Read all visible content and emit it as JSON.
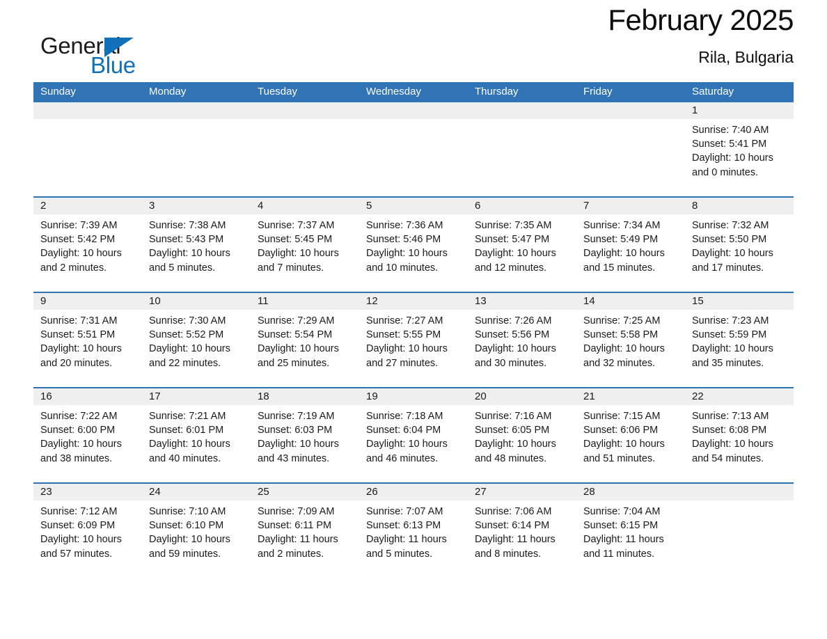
{
  "logo": {
    "word_one": "General",
    "word_two": "Blue",
    "triangle_icon": "triangle-icon",
    "brand_color": "#1270b8"
  },
  "header": {
    "title": "February 2025",
    "subtitle": "Rila, Bulgaria"
  },
  "colors": {
    "header_blue": "#3074b5",
    "row_divider_blue": "#2f72b3",
    "daynum_band": "#efefef",
    "text": "#1a1a1a"
  },
  "weekdays": [
    "Sunday",
    "Monday",
    "Tuesday",
    "Wednesday",
    "Thursday",
    "Friday",
    "Saturday"
  ],
  "labels": {
    "sunrise_prefix": "Sunrise:",
    "sunset_prefix": "Sunset:",
    "daylight_prefix": "Daylight:"
  },
  "weeks": [
    [
      {
        "day": "",
        "empty": true
      },
      {
        "day": "",
        "empty": true
      },
      {
        "day": "",
        "empty": true
      },
      {
        "day": "",
        "empty": true
      },
      {
        "day": "",
        "empty": true
      },
      {
        "day": "",
        "empty": true
      },
      {
        "day": "1",
        "sunrise": "Sunrise: 7:40 AM",
        "sunset": "Sunset: 5:41 PM",
        "daylight": "Daylight: 10 hours and 0 minutes."
      }
    ],
    [
      {
        "day": "2",
        "sunrise": "Sunrise: 7:39 AM",
        "sunset": "Sunset: 5:42 PM",
        "daylight": "Daylight: 10 hours and 2 minutes."
      },
      {
        "day": "3",
        "sunrise": "Sunrise: 7:38 AM",
        "sunset": "Sunset: 5:43 PM",
        "daylight": "Daylight: 10 hours and 5 minutes."
      },
      {
        "day": "4",
        "sunrise": "Sunrise: 7:37 AM",
        "sunset": "Sunset: 5:45 PM",
        "daylight": "Daylight: 10 hours and 7 minutes."
      },
      {
        "day": "5",
        "sunrise": "Sunrise: 7:36 AM",
        "sunset": "Sunset: 5:46 PM",
        "daylight": "Daylight: 10 hours and 10 minutes."
      },
      {
        "day": "6",
        "sunrise": "Sunrise: 7:35 AM",
        "sunset": "Sunset: 5:47 PM",
        "daylight": "Daylight: 10 hours and 12 minutes."
      },
      {
        "day": "7",
        "sunrise": "Sunrise: 7:34 AM",
        "sunset": "Sunset: 5:49 PM",
        "daylight": "Daylight: 10 hours and 15 minutes."
      },
      {
        "day": "8",
        "sunrise": "Sunrise: 7:32 AM",
        "sunset": "Sunset: 5:50 PM",
        "daylight": "Daylight: 10 hours and 17 minutes."
      }
    ],
    [
      {
        "day": "9",
        "sunrise": "Sunrise: 7:31 AM",
        "sunset": "Sunset: 5:51 PM",
        "daylight": "Daylight: 10 hours and 20 minutes."
      },
      {
        "day": "10",
        "sunrise": "Sunrise: 7:30 AM",
        "sunset": "Sunset: 5:52 PM",
        "daylight": "Daylight: 10 hours and 22 minutes."
      },
      {
        "day": "11",
        "sunrise": "Sunrise: 7:29 AM",
        "sunset": "Sunset: 5:54 PM",
        "daylight": "Daylight: 10 hours and 25 minutes."
      },
      {
        "day": "12",
        "sunrise": "Sunrise: 7:27 AM",
        "sunset": "Sunset: 5:55 PM",
        "daylight": "Daylight: 10 hours and 27 minutes."
      },
      {
        "day": "13",
        "sunrise": "Sunrise: 7:26 AM",
        "sunset": "Sunset: 5:56 PM",
        "daylight": "Daylight: 10 hours and 30 minutes."
      },
      {
        "day": "14",
        "sunrise": "Sunrise: 7:25 AM",
        "sunset": "Sunset: 5:58 PM",
        "daylight": "Daylight: 10 hours and 32 minutes."
      },
      {
        "day": "15",
        "sunrise": "Sunrise: 7:23 AM",
        "sunset": "Sunset: 5:59 PM",
        "daylight": "Daylight: 10 hours and 35 minutes."
      }
    ],
    [
      {
        "day": "16",
        "sunrise": "Sunrise: 7:22 AM",
        "sunset": "Sunset: 6:00 PM",
        "daylight": "Daylight: 10 hours and 38 minutes."
      },
      {
        "day": "17",
        "sunrise": "Sunrise: 7:21 AM",
        "sunset": "Sunset: 6:01 PM",
        "daylight": "Daylight: 10 hours and 40 minutes."
      },
      {
        "day": "18",
        "sunrise": "Sunrise: 7:19 AM",
        "sunset": "Sunset: 6:03 PM",
        "daylight": "Daylight: 10 hours and 43 minutes."
      },
      {
        "day": "19",
        "sunrise": "Sunrise: 7:18 AM",
        "sunset": "Sunset: 6:04 PM",
        "daylight": "Daylight: 10 hours and 46 minutes."
      },
      {
        "day": "20",
        "sunrise": "Sunrise: 7:16 AM",
        "sunset": "Sunset: 6:05 PM",
        "daylight": "Daylight: 10 hours and 48 minutes."
      },
      {
        "day": "21",
        "sunrise": "Sunrise: 7:15 AM",
        "sunset": "Sunset: 6:06 PM",
        "daylight": "Daylight: 10 hours and 51 minutes."
      },
      {
        "day": "22",
        "sunrise": "Sunrise: 7:13 AM",
        "sunset": "Sunset: 6:08 PM",
        "daylight": "Daylight: 10 hours and 54 minutes."
      }
    ],
    [
      {
        "day": "23",
        "sunrise": "Sunrise: 7:12 AM",
        "sunset": "Sunset: 6:09 PM",
        "daylight": "Daylight: 10 hours and 57 minutes."
      },
      {
        "day": "24",
        "sunrise": "Sunrise: 7:10 AM",
        "sunset": "Sunset: 6:10 PM",
        "daylight": "Daylight: 10 hours and 59 minutes."
      },
      {
        "day": "25",
        "sunrise": "Sunrise: 7:09 AM",
        "sunset": "Sunset: 6:11 PM",
        "daylight": "Daylight: 11 hours and 2 minutes."
      },
      {
        "day": "26",
        "sunrise": "Sunrise: 7:07 AM",
        "sunset": "Sunset: 6:13 PM",
        "daylight": "Daylight: 11 hours and 5 minutes."
      },
      {
        "day": "27",
        "sunrise": "Sunrise: 7:06 AM",
        "sunset": "Sunset: 6:14 PM",
        "daylight": "Daylight: 11 hours and 8 minutes."
      },
      {
        "day": "28",
        "sunrise": "Sunrise: 7:04 AM",
        "sunset": "Sunset: 6:15 PM",
        "daylight": "Daylight: 11 hours and 11 minutes."
      },
      {
        "day": "",
        "empty": true
      }
    ]
  ]
}
